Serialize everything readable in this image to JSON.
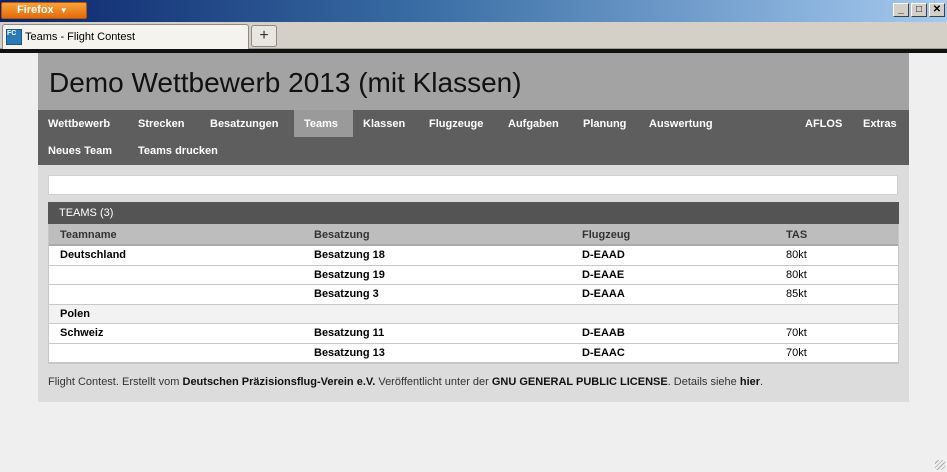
{
  "browser": {
    "menu_button": "Firefox",
    "window_buttons": [
      "_",
      "□",
      "✕"
    ],
    "tab_title": "Teams - Flight Contest",
    "tab_icon": "fc-favicon-icon",
    "new_tab": "+"
  },
  "header": {
    "title": "Demo Wettbewerb 2013 (mit Klassen)"
  },
  "nav": {
    "row1": [
      "Wettbewerb",
      "Strecken",
      "Besatzungen",
      "Teams",
      "Klassen",
      "Flugzeuge",
      "Aufgaben",
      "Planung",
      "Auswertung"
    ],
    "row1_right": [
      "AFLOS",
      "Extras"
    ],
    "row2": [
      "Neues Team",
      "Teams drucken"
    ],
    "active": "Teams"
  },
  "panel": {
    "title": "TEAMS (3)"
  },
  "table": {
    "columns": [
      "Teamname",
      "Besatzung",
      "Flugzeug",
      "TAS"
    ],
    "rows": [
      {
        "team": "Deutschland",
        "crew": "Besatzung 18",
        "plane": "D-EAAD",
        "tas": "80kt"
      },
      {
        "team": "",
        "crew": "Besatzung 19",
        "plane": "D-EAAE",
        "tas": "80kt"
      },
      {
        "team": "",
        "crew": "Besatzung 3",
        "plane": "D-EAAA",
        "tas": "85kt"
      },
      {
        "team": "Polen",
        "crew": "",
        "plane": "",
        "tas": ""
      },
      {
        "team": "Schweiz",
        "crew": "Besatzung 11",
        "plane": "D-EAAB",
        "tas": "70kt"
      },
      {
        "team": "",
        "crew": "Besatzung 13",
        "plane": "D-EAAC",
        "tas": "70kt"
      }
    ]
  },
  "footer": {
    "t1": "Flight Contest. Erstellt vom ",
    "b1": "Deutschen Präzisionsflug-Verein e.V.",
    "t2": " Veröffentlicht unter der ",
    "b2": "GNU GENERAL PUBLIC LICENSE",
    "t3": ". Details siehe ",
    "b3": "hier",
    "t4": "."
  },
  "colors": {
    "header_bg": "#a3a3a3",
    "nav_bg": "#5e5e5e",
    "nav_active": "#9a9a9a",
    "panel_head": "#545454",
    "firefox_orange": "#e36b0a"
  }
}
